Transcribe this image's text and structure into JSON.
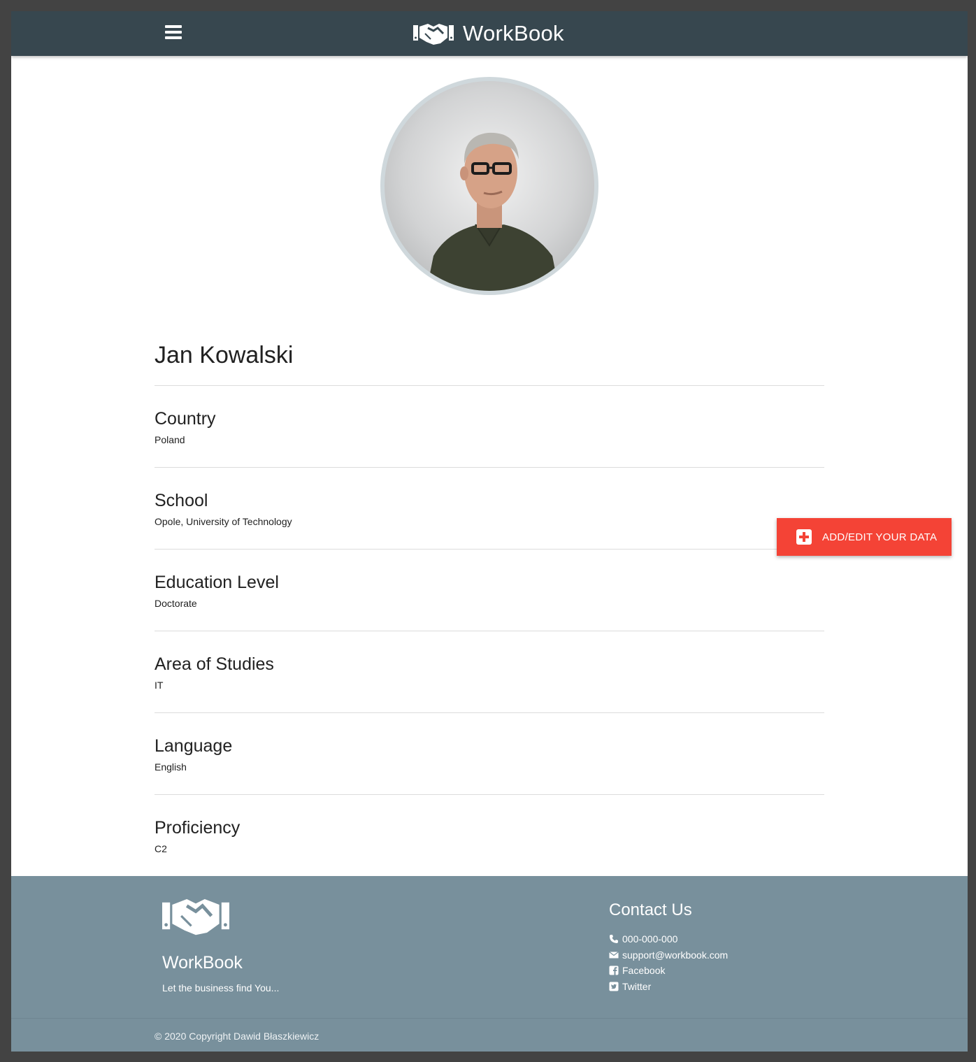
{
  "header": {
    "brand": "WorkBook",
    "menu_icon": "hamburger-menu-icon",
    "logo_icon": "handshake-icon"
  },
  "profile": {
    "name": "Jan Kowalski",
    "avatar_alt": "Profile photo",
    "fields": [
      {
        "label": "Country",
        "value": "Poland"
      },
      {
        "label": "School",
        "value": "Opole, University of Technology"
      },
      {
        "label": "Education Level",
        "value": "Doctorate"
      },
      {
        "label": "Area of Studies",
        "value": "IT"
      },
      {
        "label": "Language",
        "value": "English"
      },
      {
        "label": "Proficiency",
        "value": "C2"
      }
    ]
  },
  "action_button": {
    "label": "ADD/EDIT YOUR DATA",
    "icon": "plus-square-icon"
  },
  "footer": {
    "title": "WorkBook",
    "tagline": "Let the business find You...",
    "contact_title": "Contact Us",
    "contacts": [
      {
        "icon": "phone-icon",
        "text": "000-000-000"
      },
      {
        "icon": "envelope-icon",
        "text": "support@workbook.com"
      },
      {
        "icon": "facebook-icon",
        "text": "Facebook"
      },
      {
        "icon": "twitter-icon",
        "text": "Twitter"
      }
    ],
    "copyright": "© 2020 Copyright Dawid Błaszkiewicz"
  },
  "colors": {
    "header_bg": "#37474f",
    "footer_bg": "#78909c",
    "accent": "#f44336",
    "avatar_ring": "#cfd8dc"
  }
}
